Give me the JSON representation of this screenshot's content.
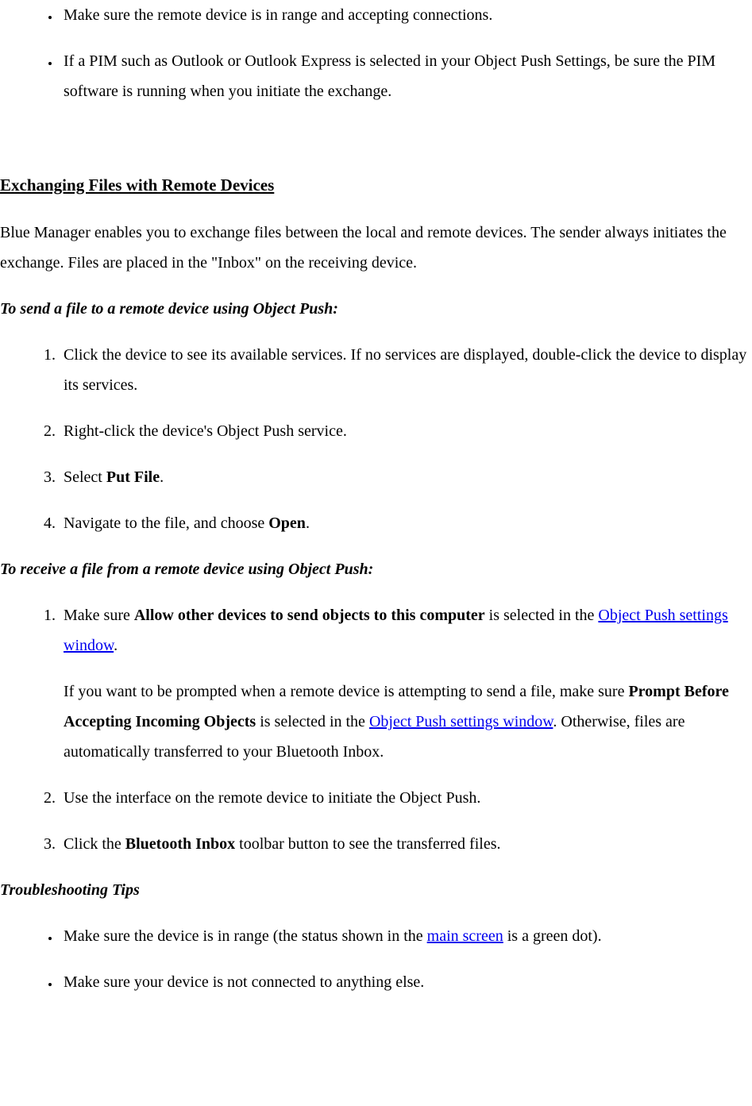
{
  "topBullets": [
    "Make sure the remote device is in range and accepting connections.",
    "If a PIM such as Outlook or Outlook Express is selected in your Object Push Settings, be sure the PIM software is running when you initiate the exchange."
  ],
  "sectionTitle": "Exchanging Files with Remote Devices",
  "intro": "Blue Manager enables you to exchange files between the local and remote devices. The sender always initiates the exchange. Files are placed in the \"Inbox\" on the receiving device.",
  "sendHeading": "To send a file to a remote device using Object Push:",
  "sendSteps": {
    "step1": "Click the device to see its available services. If no services are displayed, double-click the device to display its services.",
    "step2": "Right-click the device's Object Push service.",
    "step3_prefix": "Select ",
    "step3_bold": "Put File",
    "step3_suffix": ".",
    "step4_prefix": "Navigate to the file, and choose ",
    "step4_bold": "Open",
    "step4_suffix": "."
  },
  "receiveHeading": "To receive a file from a remote device using Object Push:",
  "receiveSteps": {
    "step1_prefix": "Make sure ",
    "step1_bold": "Allow other devices to send objects to this computer",
    "step1_mid": " is selected in the ",
    "step1_link": "Object Push settings window",
    "step1_suffix": ".",
    "step1_para_prefix": "If you want to be prompted when a remote device is attempting to send a file, make sure ",
    "step1_para_bold": "Prompt Before Accepting Incoming Objects",
    "step1_para_mid": " is selected in the ",
    "step1_para_link": "Object Push settings window",
    "step1_para_suffix": ". Otherwise, files are automatically transferred to your Bluetooth Inbox.",
    "step2": "Use the interface on the remote device to initiate the Object Push.",
    "step3_prefix": "Click the ",
    "step3_bold": "Bluetooth Inbox",
    "step3_suffix": " toolbar button to see the transferred files."
  },
  "troubleshootHeading": "Troubleshooting Tips",
  "troubleshootBullets": {
    "b1_prefix": "Make sure the device is in range (the status shown in the ",
    "b1_link": "main screen",
    "b1_suffix": " is a green dot).",
    "b2": "Make sure your device is not connected to anything else."
  }
}
